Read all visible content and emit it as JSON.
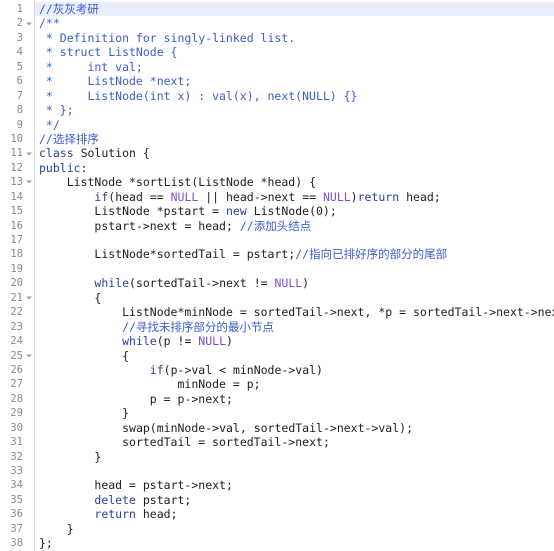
{
  "editor": {
    "name": "code-editor",
    "language": "C++",
    "total_lines": 38,
    "active_line": 1,
    "colors": {
      "background": "#ffffff",
      "gutter_text": "#8a8a8a",
      "gutter_border": "#dcdcdc",
      "active_line_bg": "#e8eefb",
      "comment": "#3c5ccc",
      "keyword": "#2b3f9e",
      "null_literal": "#7a4fd6",
      "plain_text": "#202020",
      "fold_marker": "#a0a0a0"
    },
    "fold_marker_glyph": "triangle-down",
    "fold_lines": [
      2,
      11,
      13,
      21,
      25
    ],
    "lines": [
      {
        "n": "1",
        "text": "//灰灰考研",
        "fold": false
      },
      {
        "n": "2",
        "text": "/**",
        "fold": true
      },
      {
        "n": "3",
        "text": " * Definition for singly-linked list.",
        "fold": false
      },
      {
        "n": "4",
        "text": " * struct ListNode {",
        "fold": false
      },
      {
        "n": "5",
        "text": " *     int val;",
        "fold": false
      },
      {
        "n": "6",
        "text": " *     ListNode *next;",
        "fold": false
      },
      {
        "n": "7",
        "text": " *     ListNode(int x) : val(x), next(NULL) {}",
        "fold": false
      },
      {
        "n": "8",
        "text": " * };",
        "fold": false
      },
      {
        "n": "9",
        "text": " */",
        "fold": false
      },
      {
        "n": "10",
        "text": "//选择排序",
        "fold": false
      },
      {
        "n": "11",
        "text": "class Solution {",
        "fold": true
      },
      {
        "n": "12",
        "text": "public:",
        "fold": false
      },
      {
        "n": "13",
        "text": "    ListNode *sortList(ListNode *head) {",
        "fold": true
      },
      {
        "n": "14",
        "text": "        if(head == NULL || head->next == NULL)return head;",
        "fold": false
      },
      {
        "n": "15",
        "text": "        ListNode *pstart = new ListNode(0);",
        "fold": false
      },
      {
        "n": "16",
        "text": "        pstart->next = head; //添加头结点",
        "fold": false
      },
      {
        "n": "17",
        "text": "",
        "fold": false
      },
      {
        "n": "18",
        "text": "        ListNode*sortedTail = pstart;//指向已排好序的部分的尾部",
        "fold": false
      },
      {
        "n": "19",
        "text": "",
        "fold": false
      },
      {
        "n": "20",
        "text": "        while(sortedTail->next != NULL)",
        "fold": false
      },
      {
        "n": "21",
        "text": "        {",
        "fold": true
      },
      {
        "n": "22",
        "text": "            ListNode*minNode = sortedTail->next, *p = sortedTail->next->next;",
        "fold": false
      },
      {
        "n": "23",
        "text": "            //寻找未排序部分的最小节点",
        "fold": false
      },
      {
        "n": "24",
        "text": "            while(p != NULL)",
        "fold": false
      },
      {
        "n": "25",
        "text": "            {",
        "fold": true
      },
      {
        "n": "26",
        "text": "                if(p->val < minNode->val)",
        "fold": false
      },
      {
        "n": "27",
        "text": "                    minNode = p;",
        "fold": false
      },
      {
        "n": "28",
        "text": "                p = p->next;",
        "fold": false
      },
      {
        "n": "29",
        "text": "            }",
        "fold": false
      },
      {
        "n": "30",
        "text": "            swap(minNode->val, sortedTail->next->val);",
        "fold": false
      },
      {
        "n": "31",
        "text": "            sortedTail = sortedTail->next;",
        "fold": false
      },
      {
        "n": "32",
        "text": "        }",
        "fold": false
      },
      {
        "n": "33",
        "text": "",
        "fold": false
      },
      {
        "n": "34",
        "text": "        head = pstart->next;",
        "fold": false
      },
      {
        "n": "35",
        "text": "        delete pstart;",
        "fold": false
      },
      {
        "n": "36",
        "text": "        return head;",
        "fold": false
      },
      {
        "n": "37",
        "text": "    }",
        "fold": false
      },
      {
        "n": "38",
        "text": "};",
        "fold": false
      }
    ]
  }
}
